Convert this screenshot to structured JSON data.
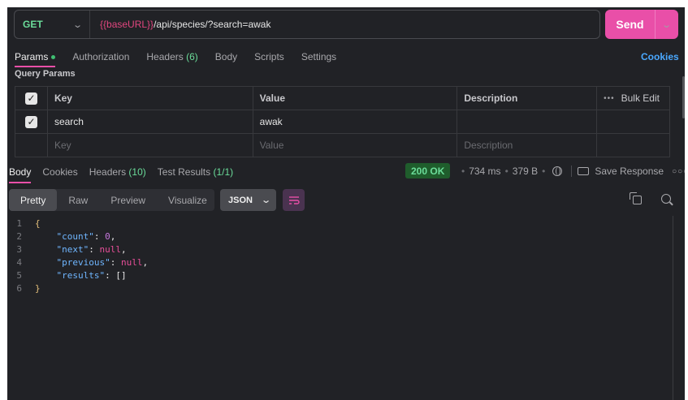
{
  "request": {
    "method": "GET",
    "url_var": "{{baseURL}}",
    "url_rest": "/api/species/?search=awak",
    "send_label": "Send"
  },
  "request_tabs": [
    {
      "label": "Params",
      "badge": ""
    },
    {
      "label": "Authorization",
      "badge": ""
    },
    {
      "label": "Headers",
      "badge": "(6)"
    },
    {
      "label": "Body",
      "badge": ""
    },
    {
      "label": "Scripts",
      "badge": ""
    },
    {
      "label": "Settings",
      "badge": ""
    }
  ],
  "cookies_label": "Cookies",
  "query_params": {
    "section_label": "Query Params",
    "columns": {
      "key": "Key",
      "value": "Value",
      "description": "Description",
      "bulk_edit": "Bulk Edit"
    },
    "rows": [
      {
        "key": "search",
        "value": "awak",
        "description": "",
        "checked": true
      }
    ],
    "placeholders": {
      "key": "Key",
      "value": "Value",
      "description": "Description"
    }
  },
  "response_tabs": [
    {
      "label": "Body",
      "badge": ""
    },
    {
      "label": "Cookies",
      "badge": ""
    },
    {
      "label": "Headers",
      "badge": "(10)"
    },
    {
      "label": "Test Results",
      "badge": "(1/1)"
    }
  ],
  "response_meta": {
    "status": "200 OK",
    "time": "734 ms",
    "size": "379 B",
    "save_label": "Save Response"
  },
  "format_tabs": [
    "Pretty",
    "Raw",
    "Preview",
    "Visualize"
  ],
  "format_select": "JSON",
  "code_lines": [
    {
      "n": "1"
    },
    {
      "n": "2",
      "key": "\"count\"",
      "val": "0"
    },
    {
      "n": "3",
      "key": "\"next\"",
      "val": "null"
    },
    {
      "n": "4",
      "key": "\"previous\"",
      "val": "null"
    },
    {
      "n": "5",
      "key": "\"results\"",
      "val": "[]"
    },
    {
      "n": "6"
    }
  ],
  "colors": {
    "accent": "#e94fa8",
    "background": "#212226",
    "status_green": "#6bdd9a",
    "link_blue": "#4aa8ff"
  }
}
